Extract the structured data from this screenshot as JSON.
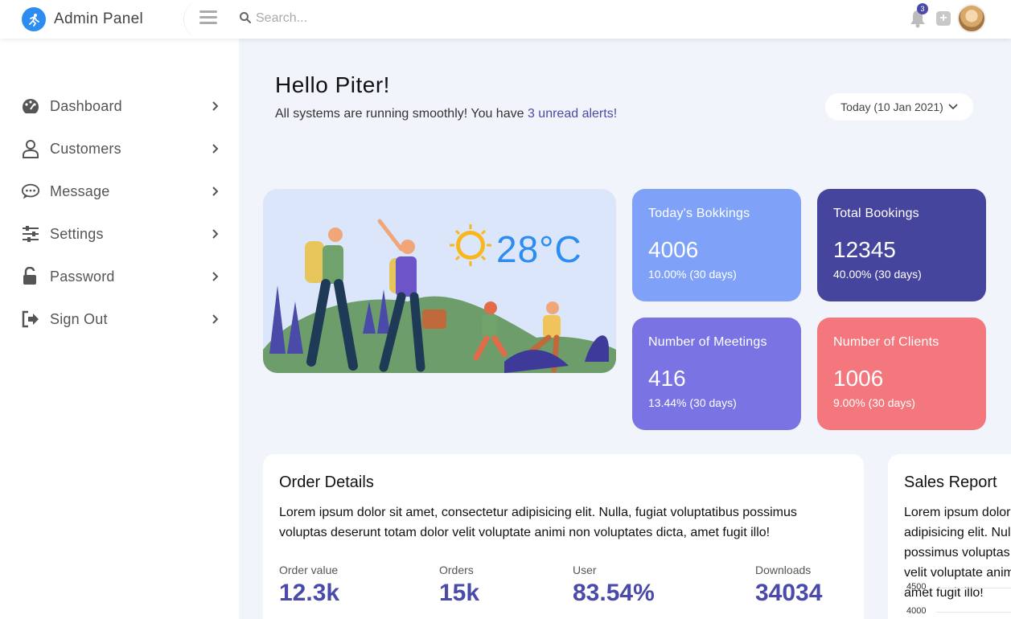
{
  "header": {
    "brand": "Admin Panel",
    "search_placeholder": "Search...",
    "notification_count": "3"
  },
  "sidebar": {
    "items": [
      {
        "label": "Dashboard",
        "icon": "palette-icon"
      },
      {
        "label": "Customers",
        "icon": "user-icon"
      },
      {
        "label": "Message",
        "icon": "chat-icon"
      },
      {
        "label": "Settings",
        "icon": "sliders-icon"
      },
      {
        "label": "Password",
        "icon": "unlock-icon"
      },
      {
        "label": "Sign Out",
        "icon": "sign-out-icon"
      }
    ]
  },
  "greeting": {
    "title": "Hello Piter!",
    "subtitle_prefix": "All systems are running smoothly! You have ",
    "alerts_link": "3 unread alerts!"
  },
  "date_filter": "Today (10 Jan 2021)",
  "weather": {
    "temperature": "28°C",
    "icon": "sun-icon"
  },
  "stats": [
    {
      "title": "Today's Bokkings",
      "value": "4006",
      "sub": "10.00% (30 days)",
      "color": "#7fa2f8"
    },
    {
      "title": "Total Bookings",
      "value": "12345",
      "sub": "40.00% (30 days)",
      "color": "#46459d"
    },
    {
      "title": "Number of Meetings",
      "value": "416",
      "sub": "13.44% (30 days)",
      "color": "#7a73e3"
    },
    {
      "title": "Number of Clients",
      "value": "1006",
      "sub": "9.00% (30 days)",
      "color": "#f3777c"
    }
  ],
  "order_details": {
    "title": "Order Details",
    "text": "Lorem ipsum dolor sit amet, consectetur adipisicing elit. Nulla, fugiat voluptatibus possimus voluptas deserunt totam dolor velit voluptate animi non voluptates dicta, amet fugit illo!",
    "metrics": [
      {
        "label": "Order value",
        "value": "12.3k"
      },
      {
        "label": "Orders",
        "value": "15k"
      },
      {
        "label": "User",
        "value": "83.54%"
      },
      {
        "label": "Downloads",
        "value": "34034"
      }
    ]
  },
  "sales_report": {
    "title": "Sales Report",
    "text": "Lorem ipsum dolor sit amet, consectetur adipisicing elit. Nulla, fugiat voluptatibus possimus voluptas deserunt totam dolor velit voluptate animi non voluptates dicta, amet fugit illo!",
    "y_ticks": [
      "4500",
      "4000"
    ]
  }
}
